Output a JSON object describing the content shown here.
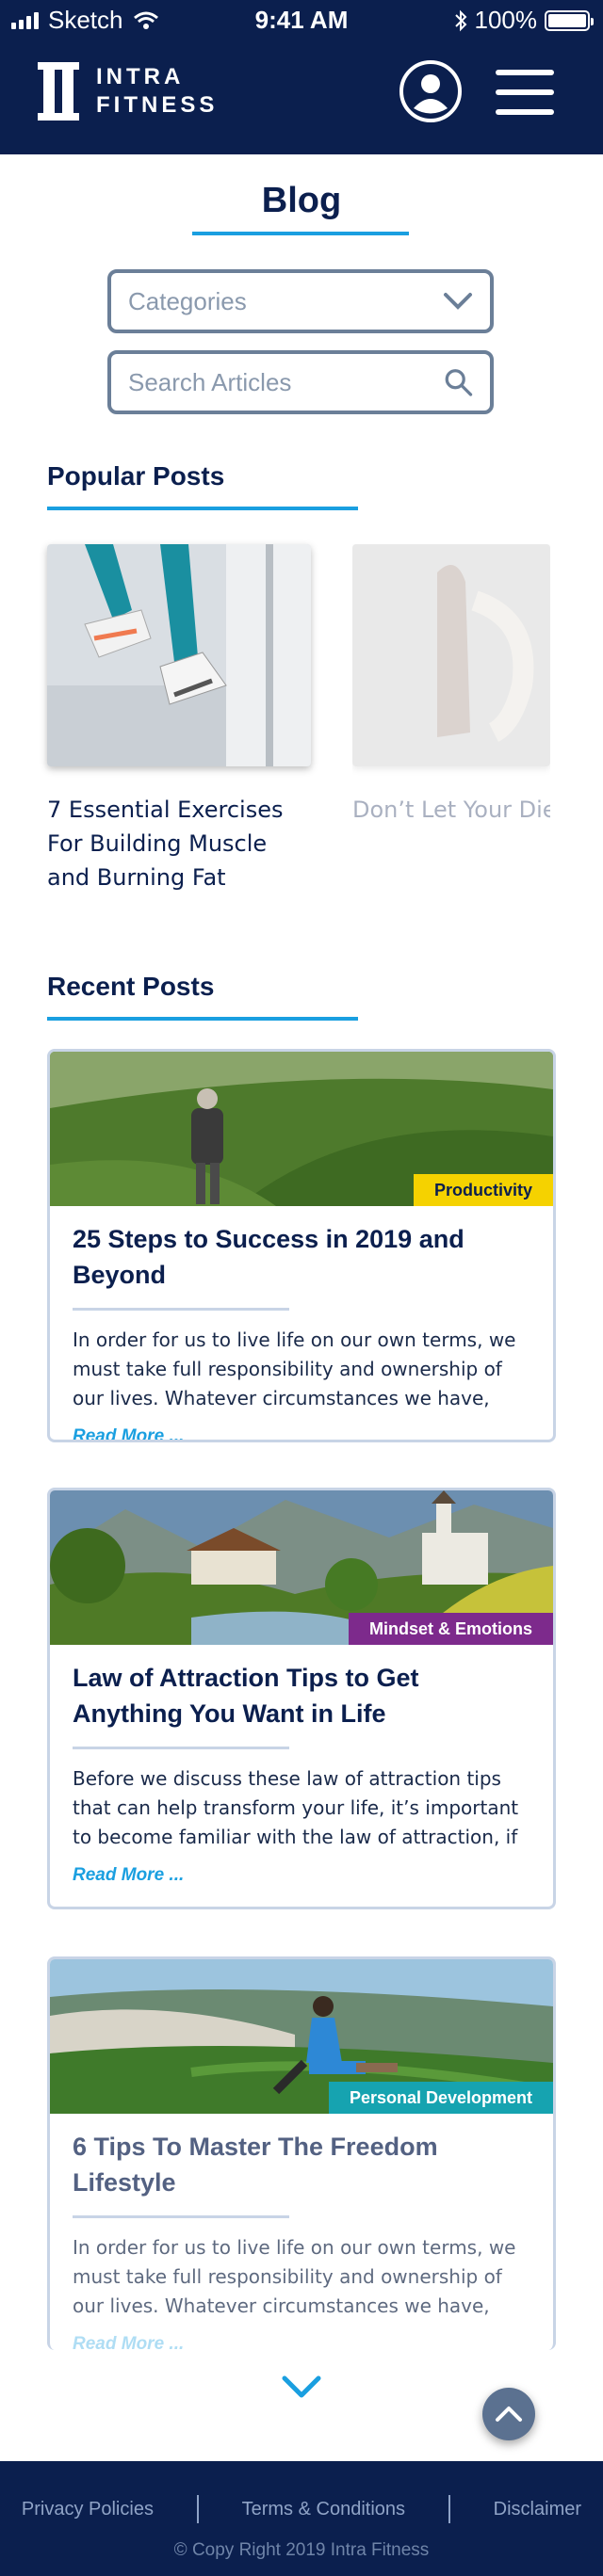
{
  "status_bar": {
    "carrier": "Sketch",
    "time": "9:41 AM",
    "battery": "100%",
    "battery_level": 1.0
  },
  "header": {
    "brand_line1": "INTRA",
    "brand_line2": "FITNESS",
    "profile_icon": "user-circle-icon",
    "menu_icon": "hamburger-icon"
  },
  "blog": {
    "title": "Blog",
    "categories_label": "Categories",
    "search_placeholder": "Search Articles"
  },
  "popular": {
    "heading": "Popular Posts",
    "posts": [
      {
        "title": "7 Essential Exercises For Building Muscle and Burning Fat"
      },
      {
        "title": "Don’t Let Your Die Of You"
      }
    ]
  },
  "recent": {
    "heading": "Recent Posts",
    "posts": [
      {
        "category": "Productivity",
        "category_bg": "#f5d200",
        "category_fg": "#0b1f4e",
        "title": "25 Steps to Success in 2019 and Beyond",
        "excerpt": "In order for us to live life on our own terms, we must take full responsibility and ownership of our lives. Whatever circumstances we have, there is always",
        "read_more": "Read More ..."
      },
      {
        "category": "Mindset & Emotions",
        "category_bg": "#7d2a8c",
        "category_fg": "#ffffff",
        "title": "Law of Attraction Tips to Get Anything You Want in Life",
        "excerpt": "Before we discuss these law of attraction tips that can help transform your life, it’s important to become familiar with the law of attraction, if",
        "read_more": "Read More ..."
      },
      {
        "category": "Personal Development",
        "category_bg": "#16a3b0",
        "category_fg": "#ffffff",
        "title": "6 Tips To Master The Freedom Lifestyle",
        "excerpt": "In order for us to live life on our own terms, we must take full responsibility and ownership of our lives. Whatever circumstances we have, there is always",
        "read_more": "Read More ..."
      }
    ]
  },
  "footer": {
    "links": [
      "Privacy Policies",
      "Terms & Conditions",
      "Disclaimer"
    ],
    "copyright": "© Copy Right 2019 Intra Fitness"
  },
  "colors": {
    "navy": "#0b1f4e",
    "accent": "#1a9fe0",
    "border": "#c8d4e6"
  }
}
